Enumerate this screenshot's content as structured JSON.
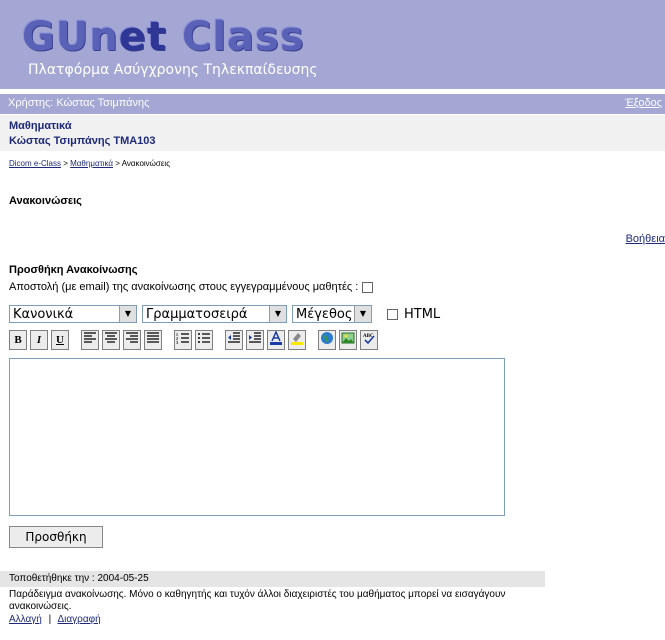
{
  "header": {
    "logo_gu": "GUn",
    "logo_e": "et",
    "logo_class": " Class",
    "subtitle": "Πλατφόρμα Ασύγχρονης Τηλεκπαίδευσης"
  },
  "userbar": {
    "user": "Χρήστης: Κώστας Τσιμπάνης",
    "logout": "Έξοδος"
  },
  "course": {
    "name": "Μαθηματικά",
    "teacher_code": "Κώστας Τσιμπάνης TMA103"
  },
  "breadcrumb": {
    "items": [
      "Dicom e-Class",
      "Μαθηματικά"
    ],
    "current": "Ανακοινώσεις",
    "sep": " > "
  },
  "page_title": "Ανακοινώσεις",
  "help_link": "Βοήθεια",
  "form": {
    "title": "Προσθήκη Ανακοίνωσης",
    "email_label": "Αποστολή (με email) της ανακοίνωσης στους εγγεγραμμένους μαθητές :",
    "style_select": "Κανονικά",
    "font_select": "Γραμματοσειρά",
    "size_select": "Μέγεθος",
    "html_label": "HTML",
    "submit": "Προσθήκη"
  },
  "toolbar": {
    "bold": "B",
    "italic": "I",
    "underline": "U"
  },
  "announcement": {
    "posted": "Τοποθετήθηκε την : 2004-05-25",
    "text": "Παράδειγμα ανακοίνωσης. Μόνο ο καθηγητής και τυχόν άλλοι διαχειριστές του μαθήματος μπορεί να εισαγάγουν ανακοινώσεις.",
    "edit": "Αλλαγή",
    "sep": "|",
    "delete": "Διαγραφή"
  }
}
